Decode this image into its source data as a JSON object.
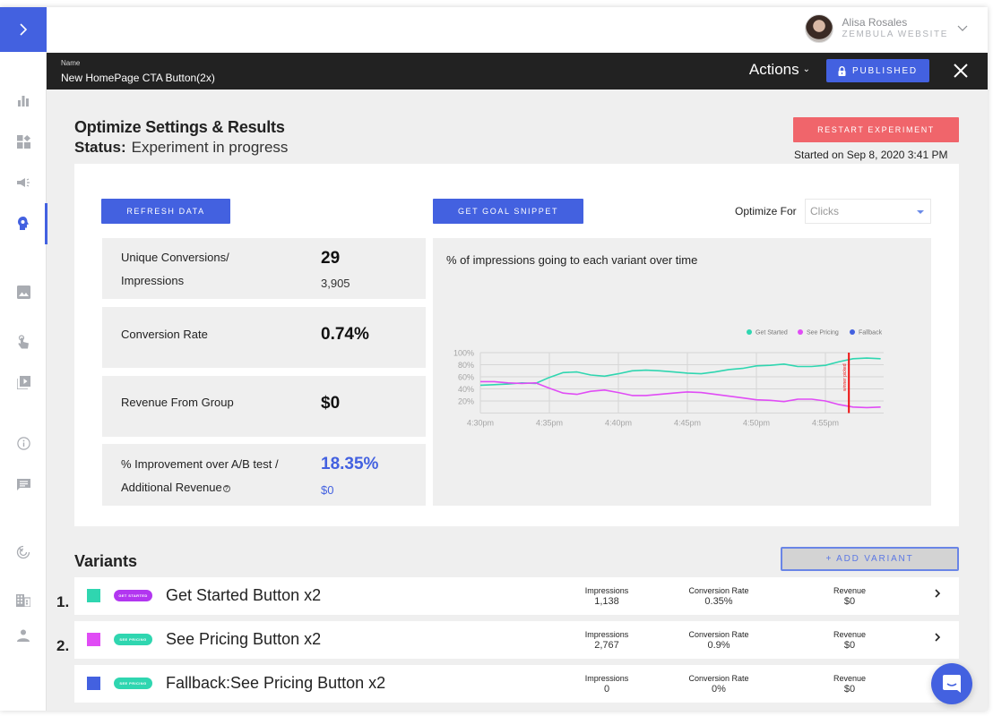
{
  "app": {
    "user": {
      "name": "Alisa Rosales",
      "org": "ZEMBULA WEBSITE"
    },
    "nav_icons": [
      "bar-chart-icon",
      "dashboard-icon",
      "megaphone-icon",
      "brain-bulb-icon",
      "image-icon",
      "touch-icon",
      "video-library-icon",
      "info-icon",
      "chat-icon",
      "radar-icon",
      "building-icon",
      "person-icon"
    ],
    "active_nav": "brain-bulb-icon"
  },
  "header": {
    "name_label": "Name",
    "name_value": "New HomePage CTA Button(2x)",
    "actions_label": "Actions",
    "published_label": "PUBLISHED"
  },
  "main": {
    "title": "Optimize Settings & Results",
    "status_label": "Status:",
    "status_value": "Experiment in progress",
    "restart_label": "RESTART EXPERIMENT",
    "started": "Started on Sep 8, 2020 3:41 PM",
    "refresh_label": "REFRESH DATA",
    "goal_snippet_label": "GET GOAL SNIPPET",
    "optimize_for_label": "Optimize For",
    "optimize_for_value": "Clicks",
    "stats": {
      "conversions_label_1": "Unique Conversions/",
      "conversions_label_2": "Impressions",
      "conversions": "29",
      "impressions": "3,905",
      "conv_rate_label": "Conversion Rate",
      "conv_rate": "0.74%",
      "revenue_label": "Revenue From Group",
      "revenue": "$0",
      "improvement_label_1": "% Improvement over A/B test /",
      "improvement_label_2": "Additional Revenue",
      "improvement_help": "?",
      "improvement": "18.35%",
      "additional_revenue": "$0"
    }
  },
  "chart_data": {
    "type": "line",
    "title": "% of impressions going to each variant over time",
    "xlabel": "",
    "ylabel": "",
    "x_ticks": [
      "4:30pm",
      "4:35pm",
      "4:40pm",
      "4:45pm",
      "4:50pm",
      "4:55pm"
    ],
    "y_ticks": [
      "20%",
      "40%",
      "60%",
      "80%",
      "100%"
    ],
    "ylim": [
      0,
      100
    ],
    "x_minutes": [
      0,
      1,
      2,
      3,
      4,
      5,
      6,
      7,
      8,
      9,
      10,
      11,
      12,
      13,
      14,
      15,
      16,
      17,
      18,
      19,
      20,
      21,
      22,
      23,
      24,
      25,
      26,
      27,
      28,
      29
    ],
    "grid": true,
    "legend_position": "top-right",
    "series": [
      {
        "name": "Get Started",
        "color": "#2fd6b0",
        "values": [
          46,
          47,
          48,
          50,
          49,
          59,
          67,
          68,
          63,
          61,
          65,
          70,
          71,
          70,
          68,
          66,
          65,
          68,
          72,
          74,
          78,
          79,
          81,
          77,
          77,
          79,
          85,
          90,
          91,
          90
        ]
      },
      {
        "name": "See Pricing",
        "color": "#e04cf5",
        "values": [
          52,
          52,
          50,
          49,
          50,
          41,
          33,
          31,
          36,
          38,
          34,
          29,
          29,
          31,
          33,
          35,
          34,
          31,
          28,
          25,
          22,
          21,
          19,
          23,
          23,
          20,
          14,
          10,
          9,
          10
        ]
      },
      {
        "name": "Fallback",
        "color": "#4361e0",
        "values": []
      }
    ],
    "annotations": [
      {
        "type": "vline",
        "x_minute": 26.7,
        "label": "winner picked",
        "color": "#ee1111"
      }
    ]
  },
  "variants": {
    "title": "Variants",
    "add_label": "+ ADD VARIANT",
    "metric_labels": {
      "impressions": "Impressions",
      "conv_rate": "Conversion Rate",
      "revenue": "Revenue"
    },
    "items": [
      {
        "rank": "1.",
        "color": "#2fd6b0",
        "pill": "GET STARTED",
        "pill_color": "#b236f0",
        "name": "Get Started Button x2",
        "impressions": "1,138",
        "conv_rate": "0.35%",
        "revenue": "$0",
        "has_chevron": true
      },
      {
        "rank": "2.",
        "color": "#e04cf5",
        "pill": "SEE PRICING",
        "pill_color": "#2fd6b0",
        "name": "See Pricing Button x2",
        "impressions": "2,767",
        "conv_rate": "0.9%",
        "revenue": "$0",
        "has_chevron": true
      },
      {
        "rank": "",
        "color": "#4361e0",
        "pill": "SEE PRICING",
        "pill_color": "#2fd6b0",
        "name": "Fallback:See Pricing Button x2",
        "impressions": "0",
        "conv_rate": "0%",
        "revenue": "$0",
        "has_chevron": false
      }
    ]
  },
  "colors": {
    "accent": "#4361e0",
    "danger": "#f0656b",
    "dark": "#222222"
  }
}
